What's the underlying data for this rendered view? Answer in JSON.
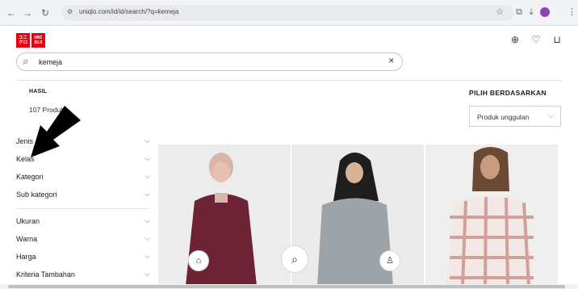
{
  "browser": {
    "url": "uniqlo.com/id/id/search/?q=kemeja",
    "back_icon": "arrow-left",
    "forward_icon": "arrow-right",
    "reload_icon": "reload"
  },
  "header": {
    "logo_left": "ユニ\nクロ",
    "logo_right": "UNI\nQLO"
  },
  "search": {
    "value": "kemeja"
  },
  "results": {
    "label": "HASIL",
    "count": "107 Produk"
  },
  "sort": {
    "label": "PILIH BERDASARKAN",
    "value": "Produk unggulan"
  },
  "filters": [
    {
      "label": "Jenis"
    },
    {
      "label": "Kelas"
    },
    {
      "label": "Kategori"
    },
    {
      "label": "Sub kategori"
    },
    {
      "label": "Ukuran"
    },
    {
      "label": "Warna"
    },
    {
      "label": "Harga"
    },
    {
      "label": "Kriteria Tambahan"
    }
  ],
  "colors": {
    "brand_red": "#e60012",
    "card1_shirt": "#6e2235",
    "card2_shirt": "#9ea3a8",
    "card3_check": "#c9958c"
  }
}
